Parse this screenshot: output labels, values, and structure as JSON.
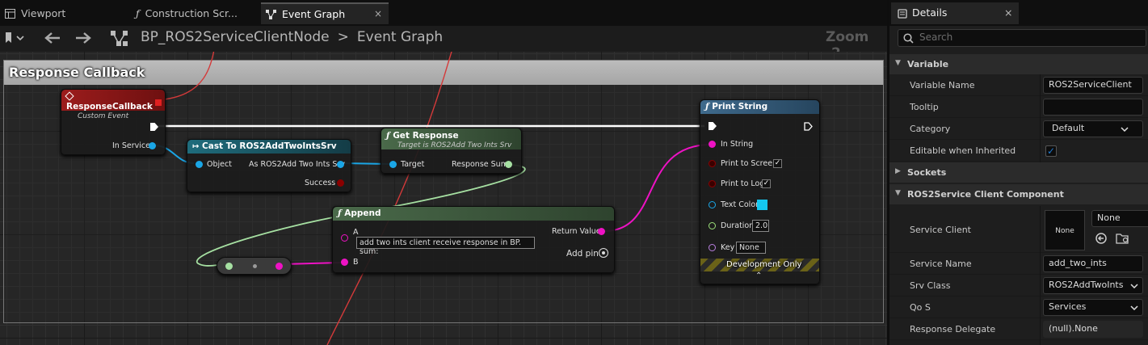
{
  "tabs": {
    "viewport": "Viewport",
    "construction": "Construction Scr...",
    "event_graph": "Event Graph",
    "close": "×"
  },
  "toolbar": {
    "breadcrumb_root": "BP_ROS2ServiceClientNode",
    "breadcrumb_sep": ">",
    "breadcrumb_current": "Event Graph",
    "zoom": "Zoom -2"
  },
  "graph": {
    "comment_title": "Response Callback",
    "nodes": {
      "response_callback": {
        "title": "ResponseCallback",
        "subtitle": "Custom Event",
        "pin_in_service": "In Service"
      },
      "cast": {
        "title": "Cast To ROS2AddTwoIntsSrv",
        "pin_object": "Object",
        "pin_as": "As ROS2Add Two Ints Srv",
        "pin_success": "Success"
      },
      "get_response": {
        "title": "Get Response",
        "subtitle": "Target is ROS2Add Two Ints Srv",
        "pin_target": "Target",
        "pin_sum": "Response Sum"
      },
      "append": {
        "title": "Append",
        "pin_a": "A",
        "pin_a_value": "add two ints client receive response in BP. sum:",
        "pin_b": "B",
        "pin_return": "Return Value",
        "add_pin": "Add pin"
      },
      "print_string": {
        "title": "Print String",
        "pin_in_string": "In String",
        "pin_print_screen": "Print to Screen",
        "pin_print_log": "Print to Log",
        "pin_text_color": "Text Color",
        "pin_duration": "Duration",
        "duration_value": "2.0",
        "pin_key": "Key",
        "key_value": "None",
        "footer": "Development Only"
      }
    }
  },
  "details": {
    "tab_title": "Details",
    "close": "×",
    "search_placeholder": "Search",
    "sections": {
      "variable": "Variable",
      "sockets": "Sockets",
      "component": "ROS2Service Client Component"
    },
    "props": {
      "variable_name_label": "Variable Name",
      "variable_name_value": "ROS2ServiceClient",
      "tooltip_label": "Tooltip",
      "tooltip_value": "",
      "category_label": "Category",
      "category_value": "Default",
      "editable_label": "Editable when Inherited",
      "service_client_label": "Service Client",
      "service_client_thumb": "None",
      "service_client_value": "None",
      "service_name_label": "Service Name",
      "service_name_value": "add_two_ints",
      "srv_class_label": "Srv Class",
      "srv_class_value": "ROS2AddTwoInts",
      "qos_label": "Qo S",
      "qos_value": "Services",
      "response_delegate_label": "Response Delegate",
      "response_delegate_value": "(null).None"
    }
  },
  "colors": {
    "event_header": "#8a1818",
    "cast_header": "#1d5a6a",
    "function_header": "#3e5a3e",
    "print_header": "#3a5a74",
    "object_pin": "#1aa6e6",
    "string_pin": "#ee12c4",
    "bool_pin": "#8a0000",
    "float_pin": "#9ce07a",
    "text_color_swatch": "#14c8f0",
    "checkbox_accent": "#1f7ad1"
  }
}
